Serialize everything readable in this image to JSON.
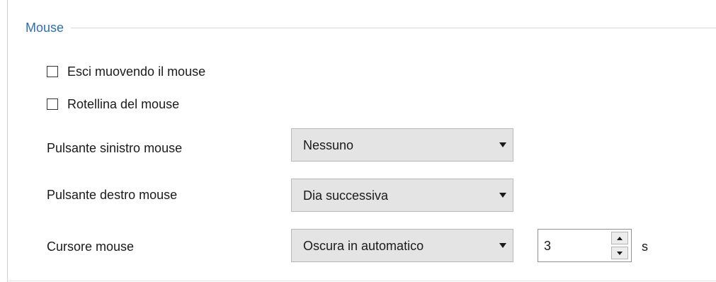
{
  "group": {
    "title": "Mouse",
    "title_color": "#2f6db5"
  },
  "checkboxes": [
    {
      "label": "Esci muovendo il mouse",
      "checked": false
    },
    {
      "label": "Rotellina del mouse",
      "checked": false
    }
  ],
  "settings": {
    "left_button": {
      "label": "Pulsante sinistro mouse",
      "value": "Nessuno"
    },
    "right_button": {
      "label": "Pulsante destro mouse",
      "value": "Dia successiva"
    },
    "cursor": {
      "label": "Cursore mouse",
      "value": "Oscura in automatico"
    }
  },
  "cursor_timeout": {
    "value": "3",
    "unit": "s"
  }
}
